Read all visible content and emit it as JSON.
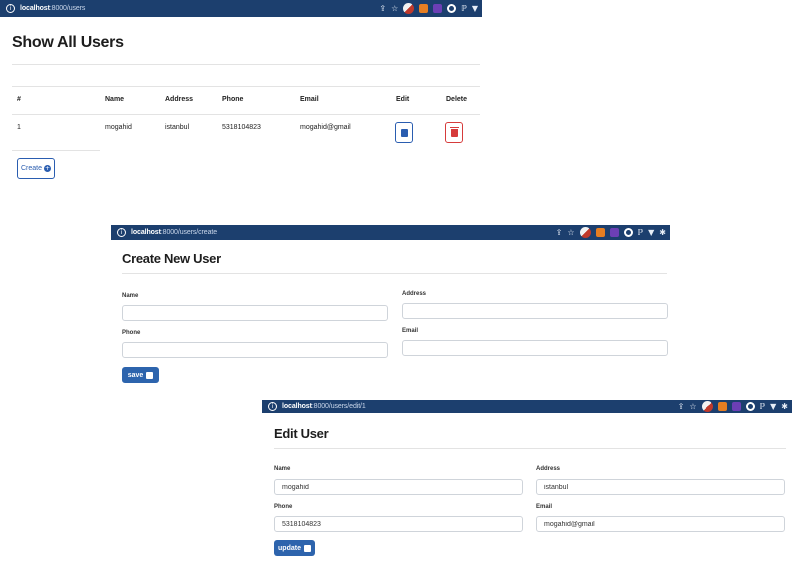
{
  "users_list": {
    "url_host": "localhost",
    "url_path": ":8000/users",
    "title": "Show All Users",
    "columns": [
      "#",
      "Name",
      "Address",
      "Phone",
      "Email",
      "Edit",
      "Delete"
    ],
    "rows": [
      {
        "id": "1",
        "name": "mogahid",
        "address": "istanbul",
        "phone": "5318104823",
        "email": "mogahid@gmail"
      }
    ],
    "create_label": "Create"
  },
  "create_form": {
    "url_host": "localhost",
    "url_path": ":8000/users/create",
    "title": "Create New User",
    "name_label": "Name",
    "address_label": "Address",
    "phone_label": "Phone",
    "email_label": "Email",
    "save_label": "save"
  },
  "edit_form": {
    "url_host": "localhost",
    "url_path": ":8000/users/edit/1",
    "title": "Edit User",
    "name_label": "Name",
    "address_label": "Address",
    "phone_label": "Phone",
    "email_label": "Email",
    "name_value": "mogahid",
    "address_value": "istanbul",
    "phone_value": "5318104823",
    "email_value": "mogahid@gmail",
    "update_label": "update"
  },
  "toolbar_icons": [
    "share-icon",
    "star-icon",
    "profile-avatar-icon",
    "fox-extension-icon",
    "badge-extension-icon",
    "ring-extension-icon",
    "p-extension-icon",
    "v-extension-icon",
    "puzzle-extension-icon"
  ],
  "colors": {
    "browser_bar": "#1c3f6e",
    "primary": "#2d64ad",
    "danger": "#d63b3b"
  }
}
